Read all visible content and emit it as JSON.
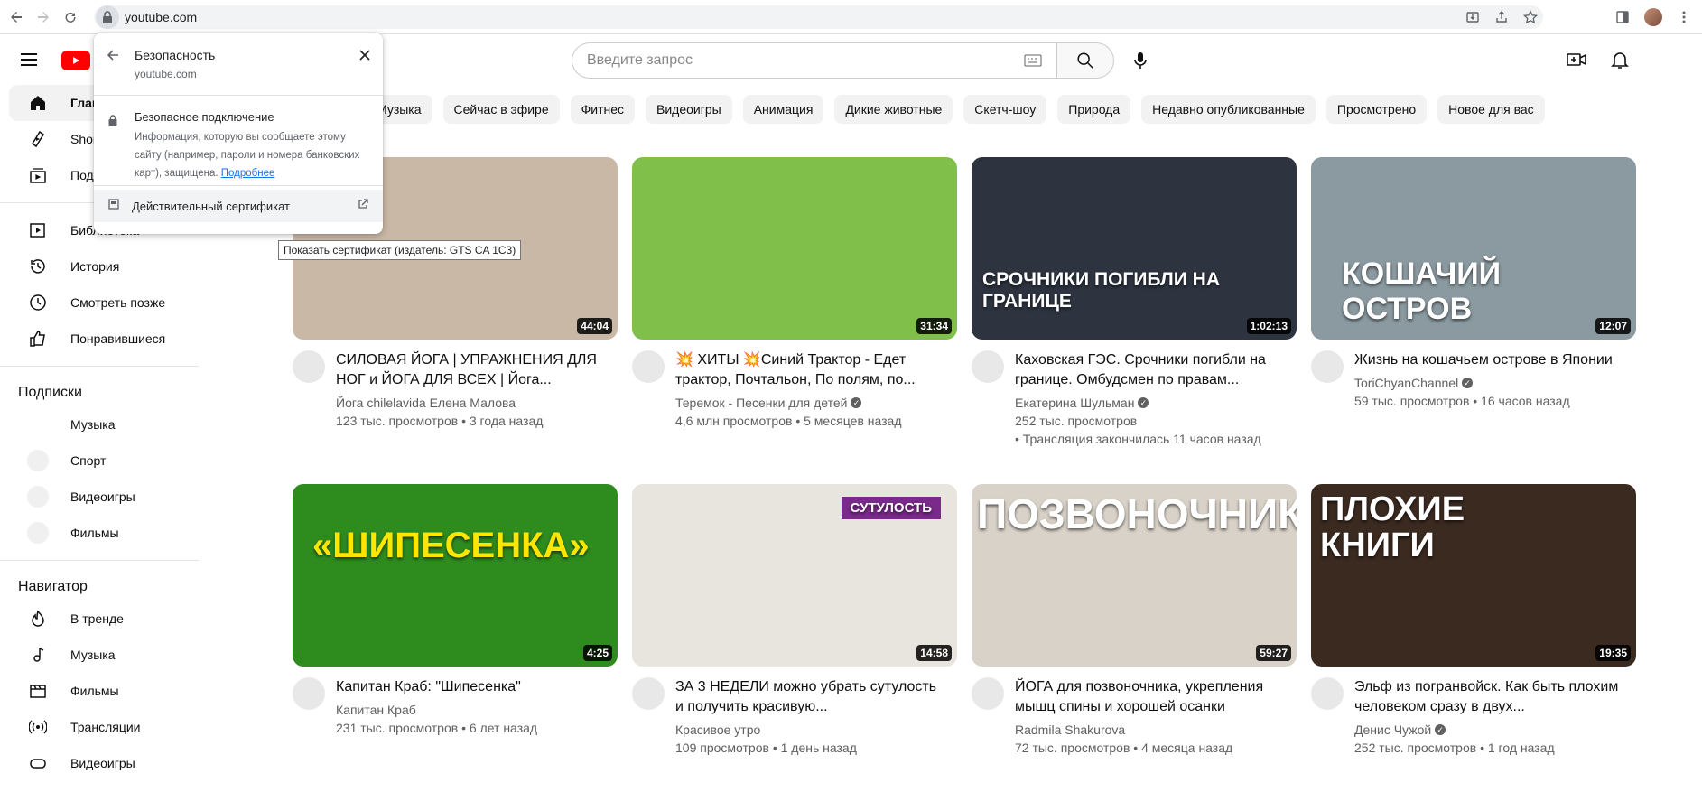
{
  "browser": {
    "url": "youtube.com"
  },
  "header": {
    "search_placeholder": "Введите запрос"
  },
  "security_popup": {
    "title": "Безопасность",
    "site": "youtube.com",
    "connection_title": "Безопасное подключение",
    "connection_desc": "Информация, которую вы сообщаете этому сайту (например, пароли и номера банковских карт), защищена.",
    "more_link": "Подробнее",
    "certificate": "Действительный сертификат",
    "tooltip": "Показать сертификат (издатель: GTS CA 1C3)"
  },
  "sidebar": {
    "main": [
      {
        "label": "Главная",
        "icon": "home-icon"
      },
      {
        "label": "Shorts",
        "icon": "shorts-icon"
      },
      {
        "label": "Подписки",
        "icon": "subscriptions-icon"
      }
    ],
    "library": [
      {
        "label": "Библиотека",
        "icon": "library-icon"
      },
      {
        "label": "История",
        "icon": "history-icon"
      },
      {
        "label": "Смотреть позже",
        "icon": "clock-icon"
      },
      {
        "label": "Понравившиеся",
        "icon": "like-icon"
      }
    ],
    "subs_title": "Подписки",
    "subs": [
      "Музыка",
      "Спорт",
      "Видеоигры",
      "Фильмы"
    ],
    "nav_title": "Навигатор",
    "nav": [
      {
        "label": "В тренде",
        "icon": "trending-icon"
      },
      {
        "label": "Музыка",
        "icon": "music-icon"
      },
      {
        "label": "Фильмы",
        "icon": "film-icon"
      },
      {
        "label": "Трансляции",
        "icon": "live-icon"
      },
      {
        "label": "Видеоигры",
        "icon": "gaming-icon"
      }
    ]
  },
  "chips": [
    "Музыка",
    "Сейчас в эфире",
    "Фитнес",
    "Видеоигры",
    "Анимация",
    "Дикие животные",
    "Скетч-шоу",
    "Природа",
    "Недавно опубликованные",
    "Просмотрено",
    "Новое для вас"
  ],
  "videos": [
    {
      "title": "СИЛОВАЯ ЙОГА | УПРАЖНЕНИЯ ДЛЯ НОГ и ЙОГА ДЛЯ ВСЕХ | Йога...",
      "channel": "Йога chilelavida Елена Малова",
      "verified": false,
      "stats": "123 тыс. просмотров • 3 года назад",
      "stats2": "",
      "duration": "44:04",
      "thumb_text": "",
      "color": "#c9b8a6"
    },
    {
      "title": "💥 ХИТЫ 💥Синий Трактор - Едет трактор, Почтальон, По полям, по...",
      "channel": "Теремок - Песенки для детей",
      "verified": true,
      "stats": "4,6 млн просмотров • 5 месяцев назад",
      "stats2": "",
      "duration": "31:34",
      "thumb_text": "",
      "color": "#7fbf4a"
    },
    {
      "title": "Каховская ГЭС. Срочники погибли на границе. Омбудсмен по правам...",
      "channel": "Екатерина Шульман",
      "verified": true,
      "stats": "252 тыс. просмотров",
      "stats2": "• Трансляция закончилась 11 часов назад",
      "duration": "1:02:13",
      "thumb_text": "СРОЧНИКИ ПОГИБЛИ НА ГРАНИЦЕ",
      "color": "#2d3440"
    },
    {
      "title": "Жизнь на кошачьем острове в Японии",
      "channel": "ToriChyanChannel",
      "verified": true,
      "stats": "59 тыс. просмотров • 16 часов назад",
      "stats2": "",
      "duration": "12:07",
      "thumb_text": "КОШАЧИЙ ОСТРОВ",
      "color": "#8a9aa0"
    },
    {
      "title": "Капитан Краб: \"Шипесенка\"",
      "channel": "Капитан Краб",
      "verified": false,
      "stats": "231 тыс. просмотров • 6 лет назад",
      "stats2": "",
      "duration": "4:25",
      "thumb_text": "«ШИПЕСЕНКА»",
      "color": "#2e8b1e"
    },
    {
      "title": "ЗА 3 НЕДЕЛИ можно убрать сутулость и получить красивую...",
      "channel": "Красивое утро",
      "verified": false,
      "stats": "109 просмотров • 1 день назад",
      "stats2": "",
      "duration": "14:58",
      "thumb_text": "СУТУЛОСТЬ",
      "color": "#e8e4de"
    },
    {
      "title": "ЙОГА для позвоночника, укрепления мышц спины и хорошей осанки",
      "channel": "Radmila Shakurova",
      "verified": false,
      "stats": "72 тыс. просмотров • 4 месяца назад",
      "stats2": "",
      "duration": "59:27",
      "thumb_text": "ПОЗВОНОЧНИК",
      "color": "#d9d2c8"
    },
    {
      "title": "Эльф из погранвойск. Как быть плохим человеком сразу в двух...",
      "channel": "Денис Чужой",
      "verified": true,
      "stats": "252 тыс. просмотров • 1 год назад",
      "stats2": "",
      "duration": "19:35",
      "thumb_text": "ПЛОХИЕ КНИГИ",
      "color": "#3b2a20"
    }
  ]
}
